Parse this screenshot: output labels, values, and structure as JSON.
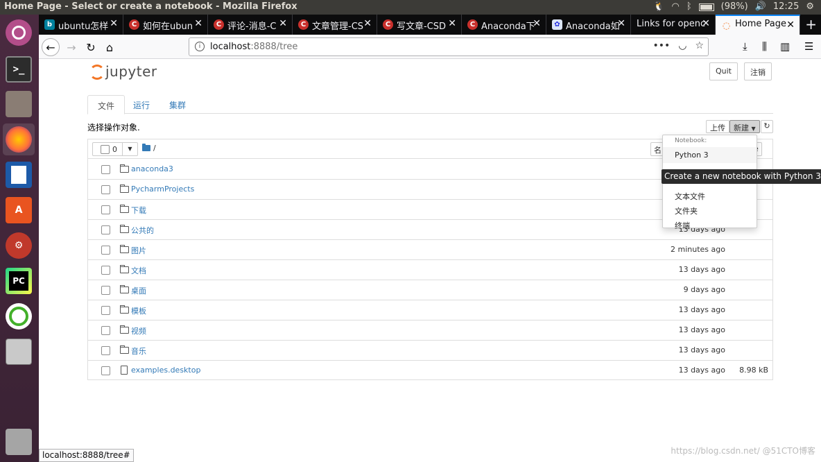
{
  "window": {
    "title": "Home Page - Select or create a notebook - Mozilla Firefox"
  },
  "system": {
    "battery": "(98%)",
    "time": "12:25"
  },
  "launcher": [
    "ubuntu-dash",
    "terminal",
    "files",
    "firefox",
    "libreoffice-writer",
    "software-center",
    "system-settings",
    "pycharm",
    "anaconda-navigator",
    "disk"
  ],
  "browser_tabs": [
    {
      "label": "ubuntu怎样",
      "fav": "b",
      "type": "bing"
    },
    {
      "label": "如何在ubun",
      "fav": "C",
      "type": "csdn"
    },
    {
      "label": "评论-消息-C",
      "fav": "C",
      "type": "csdn"
    },
    {
      "label": "文章管理-CS",
      "fav": "C",
      "type": "csdn"
    },
    {
      "label": "写文章-CSD",
      "fav": "C",
      "type": "csdn"
    },
    {
      "label": "Anaconda下",
      "fav": "C",
      "type": "csdn"
    },
    {
      "label": "Anaconda如",
      "fav": "✿",
      "type": "baidu"
    },
    {
      "label": "Links for openc",
      "fav": "",
      "type": "none"
    },
    {
      "label": "Home Page",
      "fav": "◌",
      "type": "jup",
      "active": true
    }
  ],
  "url": {
    "host": "localhost",
    "rest": ":8888/tree"
  },
  "jupyter": {
    "logo_text": "jupyter",
    "quit_label": "Quit",
    "logout_label": "注销",
    "tabs": [
      "文件",
      "运行",
      "集群"
    ],
    "select_text": "选择操作对象.",
    "upload_label": "上传",
    "new_label": "新建",
    "selected_count": "0",
    "breadcrumb": "/",
    "sort_name_partial": "名",
    "sort_right_partial": "e",
    "rows": [
      {
        "name": "anaconda3",
        "modified": "",
        "size": "",
        "kind": "folder"
      },
      {
        "name": "PycharmProjects",
        "modified": "",
        "size": "",
        "kind": "folder"
      },
      {
        "name": "下载",
        "modified": "",
        "size": "",
        "kind": "folder"
      },
      {
        "name": "公共的",
        "modified": "13 days ago",
        "size": "",
        "kind": "folder"
      },
      {
        "name": "图片",
        "modified": "2 minutes ago",
        "size": "",
        "kind": "folder"
      },
      {
        "name": "文档",
        "modified": "13 days ago",
        "size": "",
        "kind": "folder"
      },
      {
        "name": "桌面",
        "modified": "9 days ago",
        "size": "",
        "kind": "folder"
      },
      {
        "name": "模板",
        "modified": "13 days ago",
        "size": "",
        "kind": "folder"
      },
      {
        "name": "视频",
        "modified": "13 days ago",
        "size": "",
        "kind": "folder"
      },
      {
        "name": "音乐",
        "modified": "13 days ago",
        "size": "",
        "kind": "folder"
      },
      {
        "name": "examples.desktop",
        "modified": "13 days ago",
        "size": "8.98 kB",
        "kind": "file"
      }
    ],
    "dropdown": {
      "header": "Notebook:",
      "python": "Python 3",
      "items": [
        "文本文件",
        "文件夹",
        "终端"
      ]
    },
    "tooltip": "Create a new notebook with Python 3"
  },
  "statusbar": "localhost:8888/tree#",
  "watermark": "https://blog.csdn.net/   @51CTO博客",
  "colors": {
    "accent": "#337ab7",
    "jupyter_orange": "#f37626",
    "launcher": "#4a2a40"
  }
}
